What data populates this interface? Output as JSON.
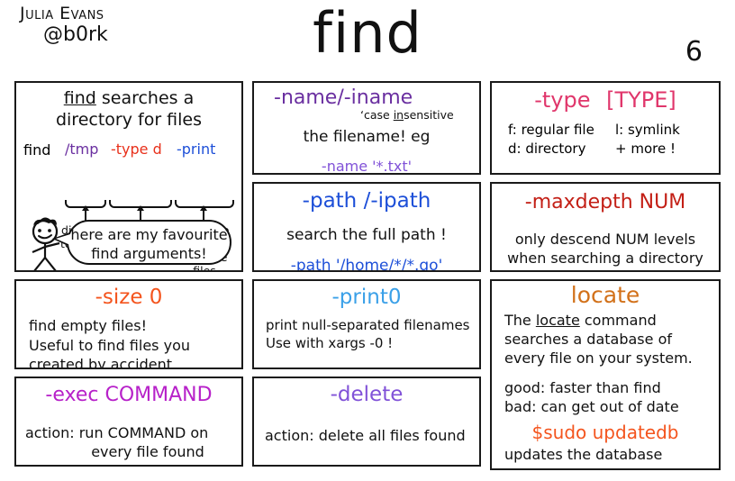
{
  "header": {
    "author_line1": "Julia Evans",
    "author_line2": "@b0rk",
    "title": "find",
    "page_number": "6"
  },
  "colors": {
    "purple": "#6a2fa0",
    "violet": "#8152d8",
    "magenta": "#b721c9",
    "blue": "#1d4fd8",
    "light_blue": "#3aa0e8",
    "red": "#e8301b",
    "dark_red": "#c31f16",
    "pink": "#e0366b",
    "orange": "#f4541d",
    "dark_orange": "#d2711a",
    "ink": "#111111"
  },
  "panels": {
    "overview": {
      "line1": "find searches a",
      "line1_underlined": "find",
      "line2": "directory for files",
      "cmd_prefix": "find",
      "cmd_arg1": "/tmp",
      "cmd_arg2": "-type d",
      "cmd_arg3": "-print",
      "caption1": "directory\nto search",
      "caption2": "which files",
      "caption3": "action to do\nwith the\nfiles",
      "speech_line1": "here are my favourite",
      "speech_line2": "find arguments!"
    },
    "name": {
      "heading": "-name/-iname",
      "annotation": "case insensitive",
      "annotation_underlined": "in",
      "body": "the filename! eg",
      "example": "-name '*.txt'"
    },
    "type": {
      "heading_flag": "-type",
      "heading_arg": "[TYPE]",
      "options_left": [
        "f: regular file",
        "d: directory"
      ],
      "options_right": [
        "l: symlink",
        "+ more !"
      ]
    },
    "path": {
      "heading": "-path /-ipath",
      "body": "search the full path !",
      "example": "-path '/home/*/*.go'"
    },
    "maxdepth": {
      "heading": "-maxdepth NUM",
      "body_line1": "only descend NUM levels",
      "body_line2": "when searching a directory"
    },
    "size": {
      "heading": "-size 0",
      "body_line1": "find empty files!",
      "body_line2": "Useful to find files you",
      "body_line3": "created by accident"
    },
    "print0": {
      "heading": "-print0",
      "body_line1": "print null-separated filenames",
      "body_line2": "Use with xargs -0 !"
    },
    "locate": {
      "heading": "locate",
      "body_line1_a": "The ",
      "body_line1_b": "locate",
      "body_line1_c": " command",
      "body_line2": "searches a database of",
      "body_line3": "every file on your system.",
      "good_line": "good: faster than find",
      "bad_line": "bad: can get out of date",
      "command": "$sudo updatedb",
      "footer": "updates the database"
    },
    "exec": {
      "heading": "-exec COMMAND",
      "body_line1": "action: run COMMAND on",
      "body_line2": "every file found"
    },
    "delete": {
      "heading": "-delete",
      "body_line1": "action: delete all files found"
    }
  }
}
